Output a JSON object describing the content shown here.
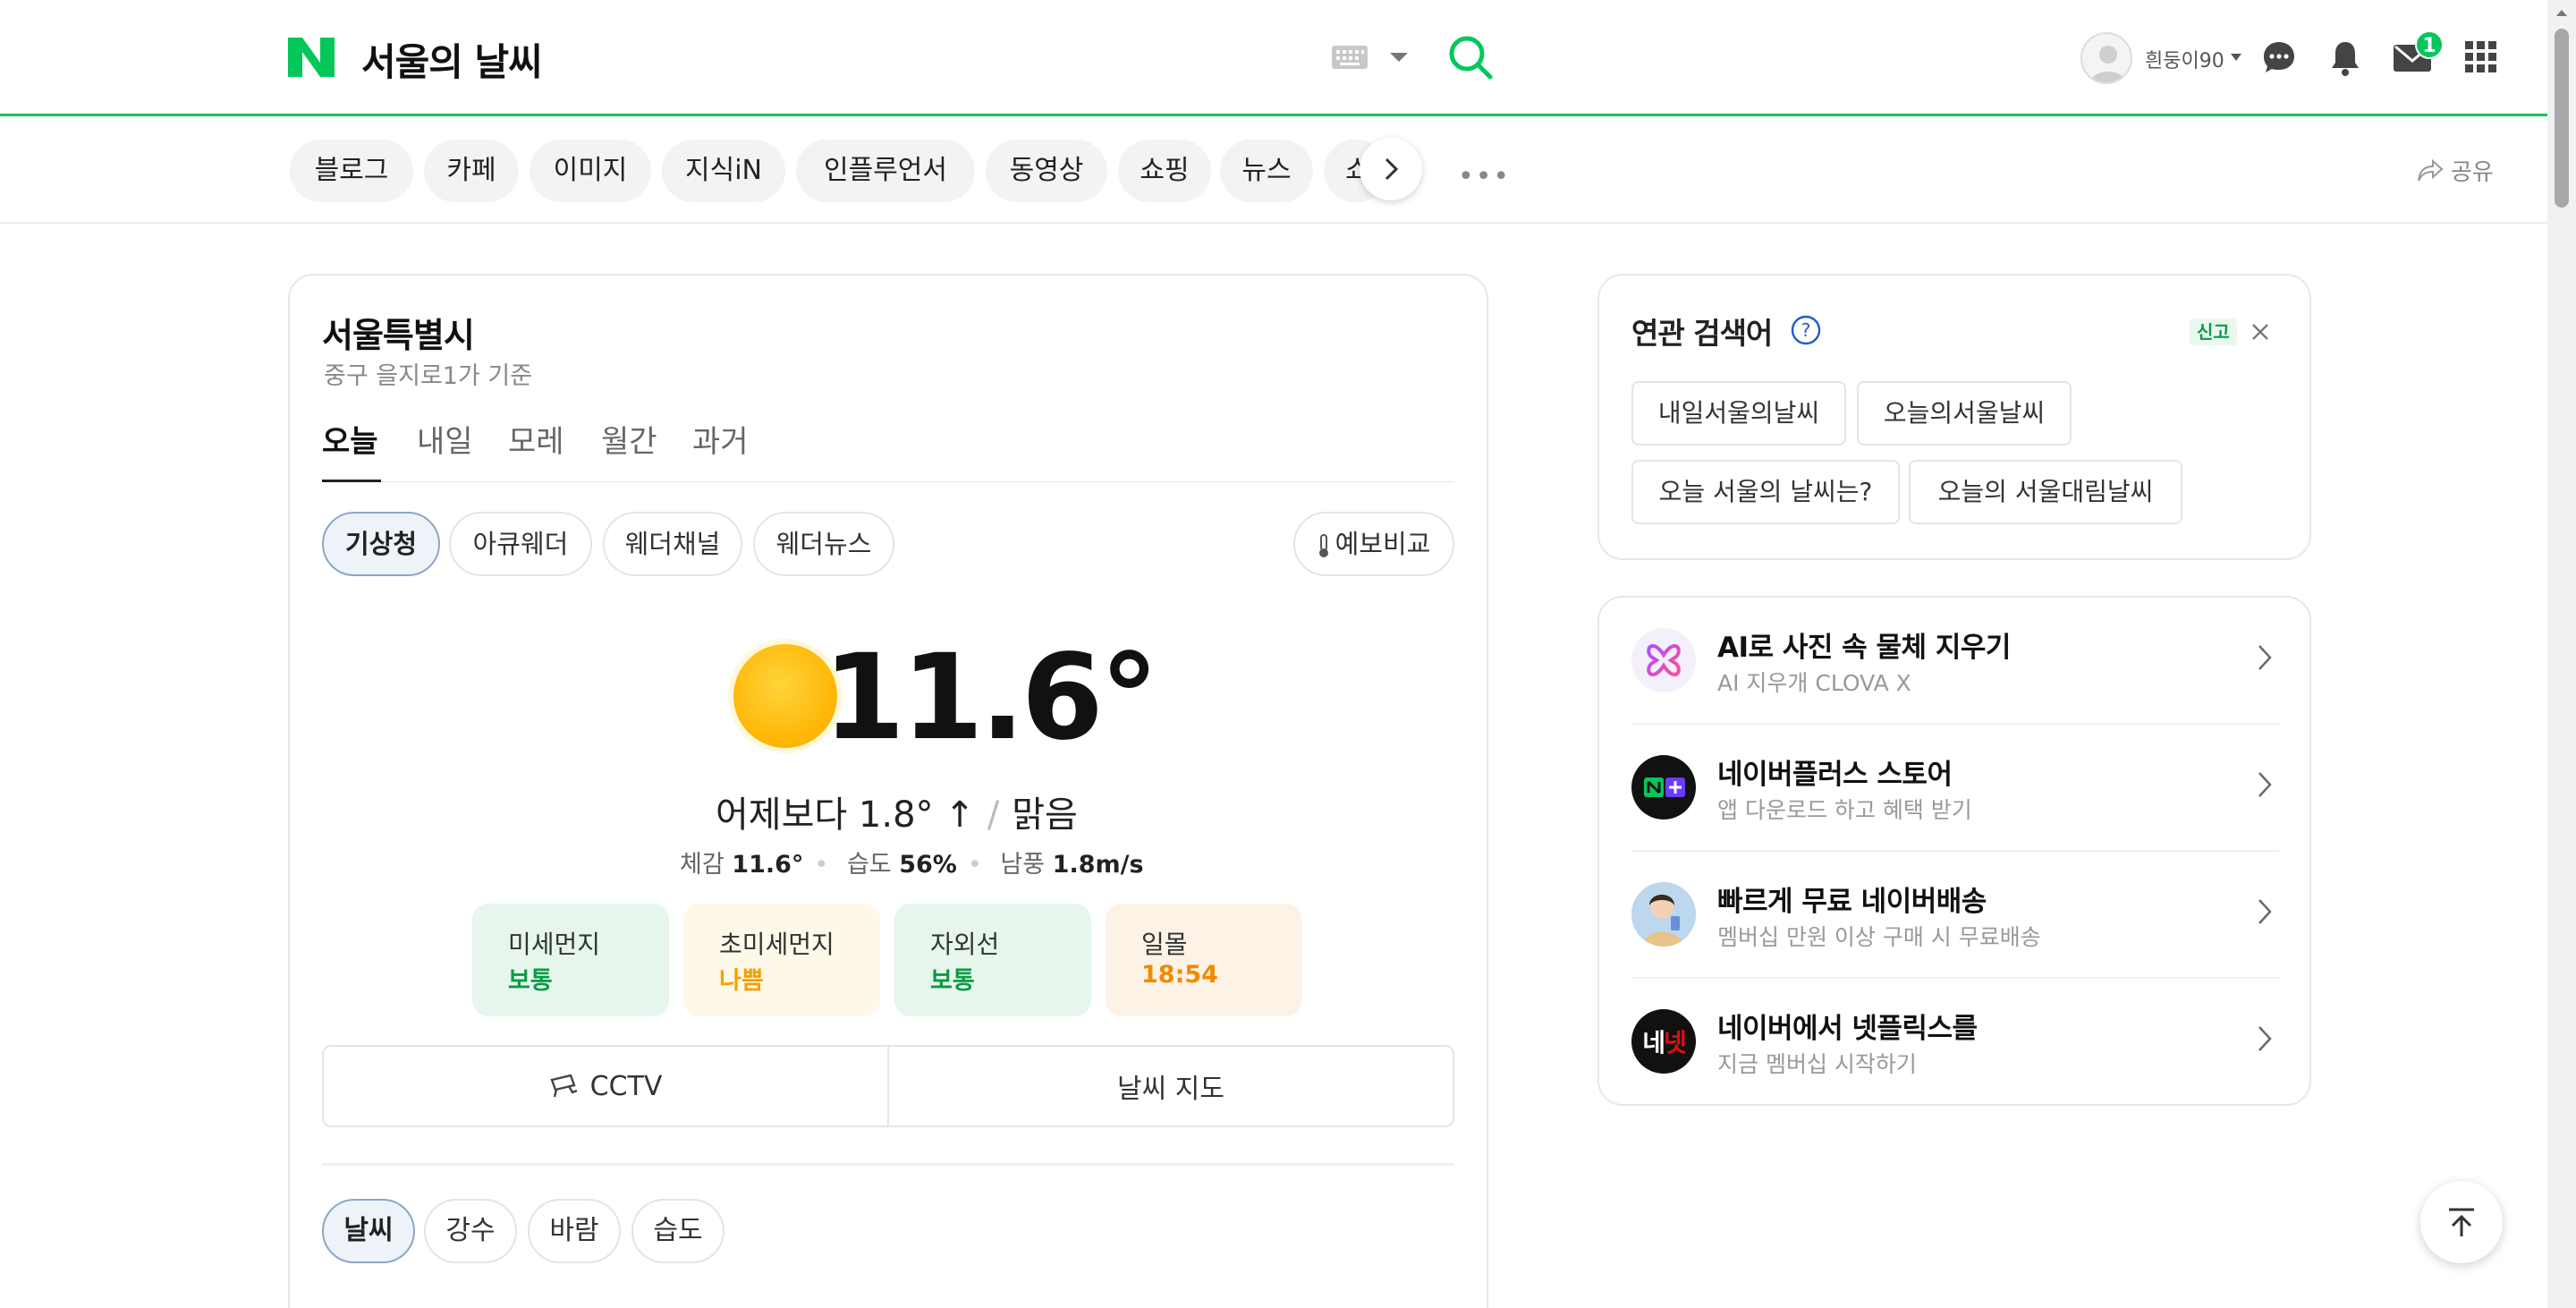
{
  "header": {
    "title": "서울의 날씨",
    "logo_letter": "N",
    "username": "흰둥이90",
    "mail_count": "1",
    "brand_color": "#03c75a"
  },
  "search_tabs": {
    "items": [
      "블로그",
      "카페",
      "이미지",
      "지식iN",
      "인플루언서",
      "동영상",
      "쇼핑",
      "뉴스",
      "쇼"
    ],
    "more": "•••",
    "share": "공유"
  },
  "weather": {
    "location": "서울특별시",
    "sublocation": "중구 을지로1가 기준",
    "day_tabs": [
      "오늘",
      "내일",
      "모레",
      "월간",
      "과거"
    ],
    "sources": [
      "기상청",
      "아큐웨더",
      "웨더채널",
      "웨더뉴스"
    ],
    "compare_button": "예보비교",
    "temperature": "11.6°",
    "vs_yesterday": "어제보다 1.8° ↑",
    "condition": "맑음",
    "details": {
      "feels_label": "체감",
      "feels_value": "11.6°",
      "humidity_label": "습도",
      "humidity_value": "56%",
      "wind_label": "남풍",
      "wind_value": "1.8m/s"
    },
    "air_cards": [
      {
        "label": "미세먼지",
        "value": "보통",
        "tone": "good"
      },
      {
        "label": "초미세먼지",
        "value": "나쁨",
        "tone": "bad"
      },
      {
        "label": "자외선",
        "value": "보통",
        "tone": "good"
      },
      {
        "label": "일몰",
        "value": "18:54",
        "tone": "sunset"
      }
    ],
    "bottom_buttons": [
      "CCTV",
      "날씨 지도"
    ],
    "metric_tabs": [
      "날씨",
      "강수",
      "바람",
      "습도"
    ]
  },
  "related": {
    "title": "연관 검색어",
    "report": "신고",
    "keywords": [
      "내일서울의날씨",
      "오늘의서울날씨",
      "오늘 서울의 날씨는?",
      "오늘의 서울대림날씨"
    ]
  },
  "promos": [
    {
      "title": "AI로 사진 속 물체 지우기",
      "subtitle": "AI 지우개 CLOVA X",
      "icon": "clova-x-icon"
    },
    {
      "title": "네이버플러스 스토어",
      "subtitle": "앱 다운로드 하고 혜택 받기",
      "icon": "naver-plus-icon"
    },
    {
      "title": "빠르게 무료 네이버배송",
      "subtitle": "멤버십 만원 이상 구매 시 무료배송",
      "icon": "person-thumbnail"
    },
    {
      "title": "네이버에서 넷플릭스를",
      "subtitle": "지금 멤버십 시작하기",
      "icon": "netflix-naver-icon",
      "icon_text": "네넷"
    }
  ]
}
